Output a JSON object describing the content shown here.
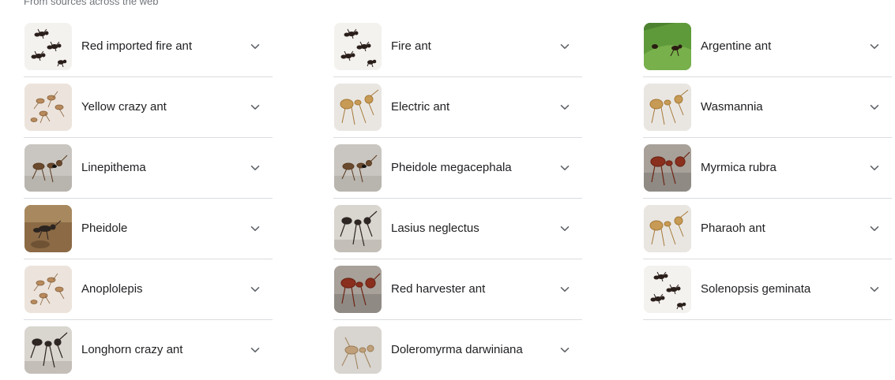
{
  "caption": "From sources across the web",
  "columns": [
    {
      "items": [
        {
          "label": "Red imported fire ant",
          "thumb": "white-ants"
        },
        {
          "label": "Yellow crazy ant",
          "thumb": "pale-cluster"
        },
        {
          "label": "Linepithema",
          "thumb": "specimen-gray"
        },
        {
          "label": "Pheidole",
          "thumb": "brown-ground"
        },
        {
          "label": "Anoplolepis",
          "thumb": "pale-cluster"
        },
        {
          "label": "Longhorn crazy ant",
          "thumb": "dark-specimen"
        }
      ]
    },
    {
      "items": [
        {
          "label": "Fire ant",
          "thumb": "white-ants"
        },
        {
          "label": "Electric ant",
          "thumb": "tan-specimen"
        },
        {
          "label": "Pheidole megacephala",
          "thumb": "specimen-gray"
        },
        {
          "label": "Lasius neglectus",
          "thumb": "dark-specimen"
        },
        {
          "label": "Red harvester ant",
          "thumb": "red-specimen"
        },
        {
          "label": "Doleromyrma darwiniana",
          "thumb": "pale-specimen"
        }
      ]
    },
    {
      "items": [
        {
          "label": "Argentine ant",
          "thumb": "green-leaf"
        },
        {
          "label": "Wasmannia",
          "thumb": "tan-specimen"
        },
        {
          "label": "Myrmica rubra",
          "thumb": "red-specimen"
        },
        {
          "label": "Pharaoh ant",
          "thumb": "tan-specimen"
        },
        {
          "label": "Solenopsis geminata",
          "thumb": "white-ants"
        }
      ]
    }
  ],
  "colors": {
    "divider": "#dadce0",
    "text": "#202124",
    "caption": "#70757a",
    "chevron": "#5f6368"
  },
  "icons": {
    "expand": "chevron-down-icon"
  }
}
